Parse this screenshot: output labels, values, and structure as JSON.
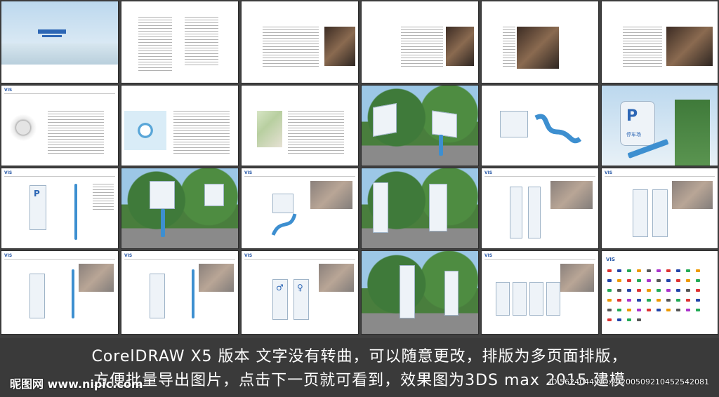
{
  "caption": {
    "line1": "CorelDRAW X5 版本 文字没有转曲，可以随意更改，排版为多页面排版，",
    "line2": "方便批量导出图片，点击下一页就可看到，效果图为3DS max 2015 建模"
  },
  "watermark": {
    "left": "昵图网 www.nipic.com",
    "right": "ID:5624044 NO:20200509210452542081"
  },
  "page_header": "VIS",
  "sign_label": "停车场",
  "restroom_labels": [
    "男卫生间",
    "女卫生间"
  ]
}
